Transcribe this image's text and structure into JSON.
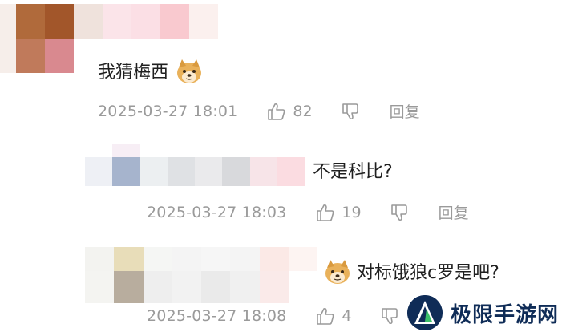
{
  "comments": [
    {
      "text": "我猜梅西",
      "emoji": "doge-emoji",
      "timestamp": "2025-03-27 18:01",
      "likes": "82",
      "reply_label": "回复"
    },
    {
      "text": "不是科比?",
      "timestamp": "2025-03-27 18:03",
      "likes": "19",
      "reply_label": "回复"
    },
    {
      "text": "对标饿狼c罗是吧?",
      "emoji": "doge-emoji",
      "timestamp": "2025-03-27 18:08",
      "likes": "4"
    }
  ],
  "watermark": {
    "text": "极限手游网"
  },
  "colors": {
    "meta_gray": "#9a9a9a",
    "text": "#1f1f1f",
    "watermark": "#0f2c57"
  }
}
